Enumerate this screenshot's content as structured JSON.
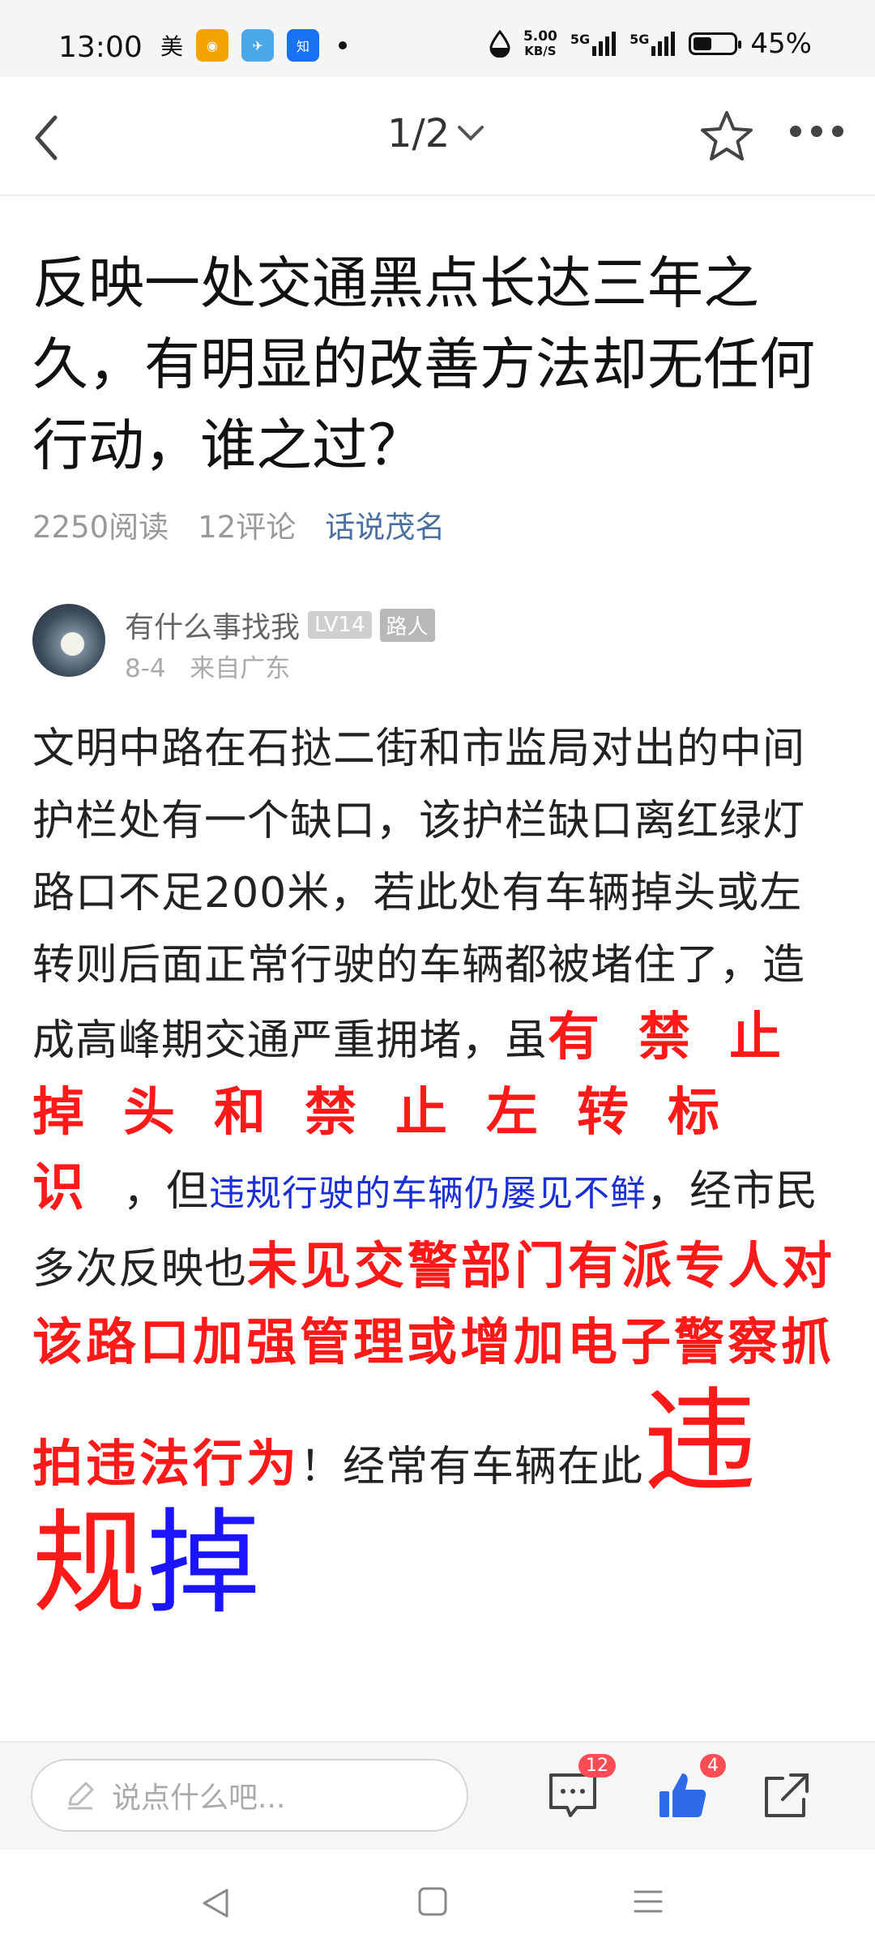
{
  "status_bar": {
    "time": "13:00",
    "app_label": "美",
    "speed_value": "5.00",
    "speed_unit": "KB/S",
    "network_1": "5G",
    "network_2": "5G",
    "battery_percent": "45%",
    "battery_level": 0.45
  },
  "nav": {
    "page_indicator": "1/2"
  },
  "article": {
    "title": "反映一处交通黑点长达三年之久，有明显的改善方法却无任何行动，谁之过？",
    "reads": "2250阅读",
    "comments": "12评论",
    "topic": "话说茂名"
  },
  "author": {
    "name": "有什么事找我",
    "level": "LV14",
    "rank": "路人",
    "date": "8-4",
    "location": "来自广东"
  },
  "body": {
    "p1": "文明中路在石挞二街和市监局对出的中间护栏处有一个缺口，该护栏缺口离红绿灯路口不足200米，若此处有车辆掉头或左转则后面正常行驶的车辆都被堵住了，造成高峰期交通严重拥堵，虽",
    "red_spaced": "有禁止掉头和禁止左转标识",
    "comma": "，但",
    "blue_text": "违规行驶的车辆仍屡见不鲜",
    "mid_text": "，经市民多次反映也",
    "red_bold": "未见交警部门有派专人对该路口加强管理或增加电子警察抓拍违法行为",
    "after_red": "！经常有车辆在此",
    "huge_red": "违规",
    "huge_blue": "掉"
  },
  "bottom_bar": {
    "input_placeholder": "说点什么吧...",
    "comment_count": "12",
    "like_count": "4"
  }
}
